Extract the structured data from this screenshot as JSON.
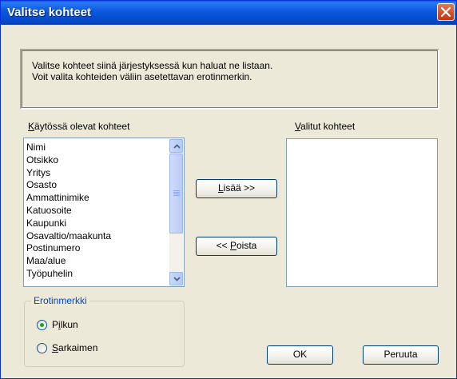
{
  "window": {
    "title": "Valitse kohteet"
  },
  "info": {
    "line1": "Valitse kohteet siinä järjestyksessä kun haluat ne listaan.",
    "line2": "Voit valita kohteiden väliin asetettavan erotinmerkin."
  },
  "available": {
    "label_first": "K",
    "label_rest": "äytössä olevat kohteet",
    "items": [
      "Nimi",
      "Otsikko",
      "Yritys",
      "Osasto",
      "Ammattinimike",
      "Katuosoite",
      "Kaupunki",
      "Osavaltio/maakunta",
      "Postinumero",
      "Maa/alue",
      "Työpuhelin"
    ]
  },
  "selected": {
    "label_first": "V",
    "label_rest": "alitut kohteet"
  },
  "buttons": {
    "add_first": "L",
    "add_rest": "isää >>",
    "remove_prefix": "<< ",
    "remove_first": "P",
    "remove_rest": "oista",
    "ok": "OK",
    "cancel": "Peruuta"
  },
  "separator": {
    "legend": "Erotinmerkki",
    "comma_a": "P",
    "comma_b": "i",
    "comma_c": "lkun",
    "tab_first": "S",
    "tab_rest": "arkaimen",
    "selected": "comma"
  },
  "icons": {
    "close": "close-icon",
    "scroll_up": "chevron-up-icon",
    "scroll_down": "chevron-down-icon"
  },
  "colors": {
    "titlebar": "#0b5be0",
    "dialog": "#ece9d8",
    "close": "#d44b22",
    "radio_selected": "#21a121",
    "group_legend": "#0046d5"
  }
}
